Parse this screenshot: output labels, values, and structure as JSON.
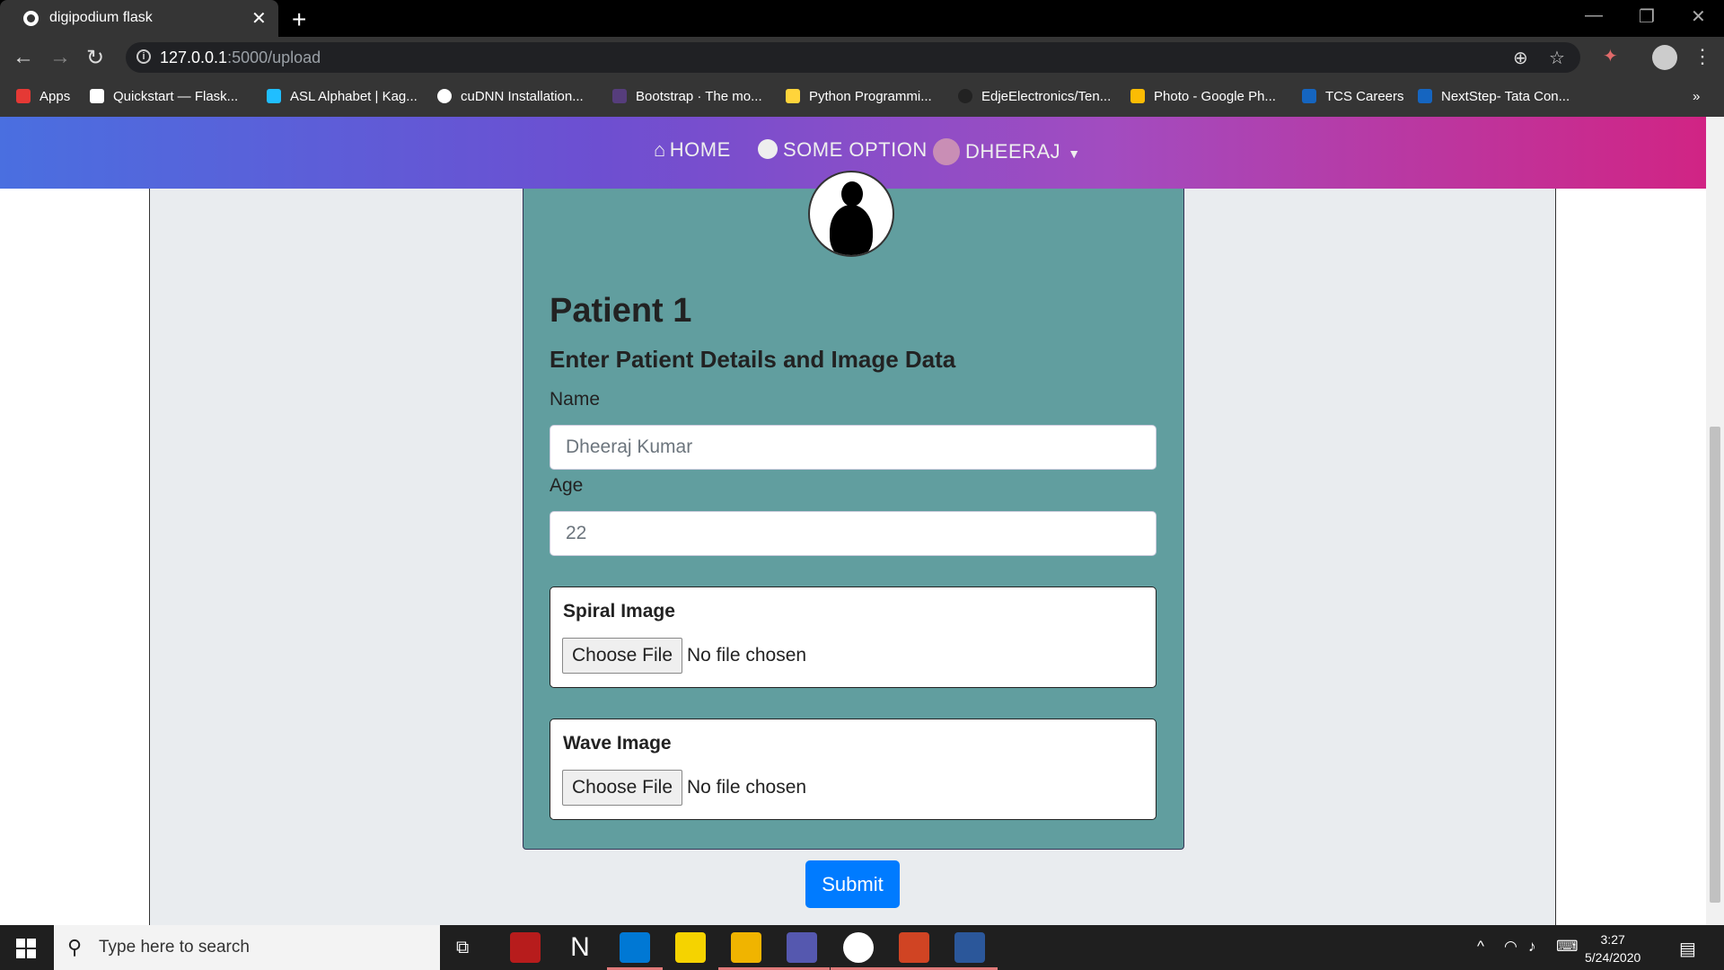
{
  "browser": {
    "tab_title": "digipodium flask",
    "url_host": "127.0.0.1",
    "url_path": ":5000/upload",
    "bookmarks": [
      {
        "label": "Apps",
        "color": "#e53935"
      },
      {
        "label": "Quickstart — Flask...",
        "color": "#ffffff"
      },
      {
        "label": "ASL Alphabet | Kag...",
        "color": "#20beff"
      },
      {
        "label": "cuDNN Installation...",
        "color": "#ffffff"
      },
      {
        "label": "Bootstrap · The mo...",
        "color": "#563d7c"
      },
      {
        "label": "Python Programmi...",
        "color": "#ffd43b"
      },
      {
        "label": "EdjeElectronics/Ten...",
        "color": "#222222"
      },
      {
        "label": "Photo - Google Ph...",
        "color": "#fbbc04"
      },
      {
        "label": "TCS Careers",
        "color": "#1565c0"
      },
      {
        "label": "NextStep- Tata Con...",
        "color": "#1565c0"
      }
    ]
  },
  "nav": {
    "home": "HOME",
    "option": "SOME OPTION",
    "user": "DHEERAJ"
  },
  "form": {
    "title": "Patient 1",
    "subtitle": "Enter Patient Details and Image Data",
    "name_label": "Name",
    "name_placeholder": "Dheeraj Kumar",
    "age_label": "Age",
    "age_placeholder": "22",
    "spiral_title": "Spiral Image",
    "wave_title": "Wave Image",
    "choose_file": "Choose File",
    "no_file": "No file chosen",
    "submit": "Submit"
  },
  "taskbar": {
    "search_placeholder": "Type here to search",
    "time": "3:27",
    "date": "5/24/2020"
  },
  "colors": {
    "navbar_start": "#4a6fe0",
    "navbar_end": "#d12484",
    "card": "#619e9f",
    "submit": "#007bff"
  }
}
